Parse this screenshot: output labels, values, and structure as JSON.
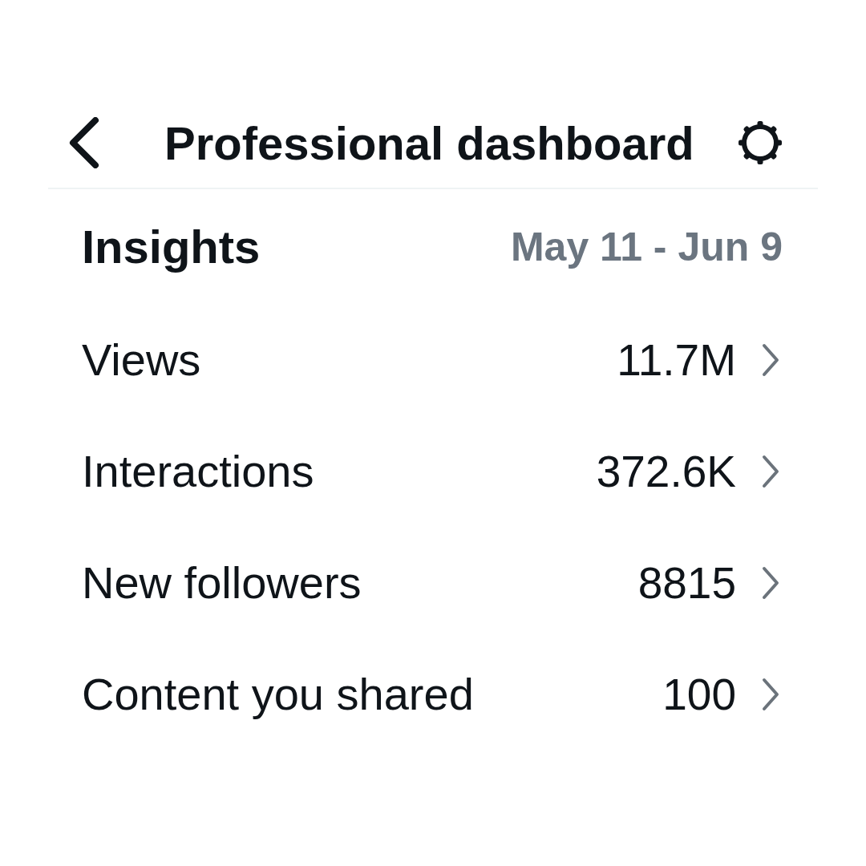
{
  "header": {
    "title": "Professional dashboard"
  },
  "insights": {
    "title": "Insights",
    "date_range": "May 11 - Jun 9"
  },
  "metrics": [
    {
      "label": "Views",
      "value": "11.7M"
    },
    {
      "label": "Interactions",
      "value": "372.6K"
    },
    {
      "label": "New followers",
      "value": "8815"
    },
    {
      "label": "Content you shared",
      "value": "100"
    }
  ]
}
